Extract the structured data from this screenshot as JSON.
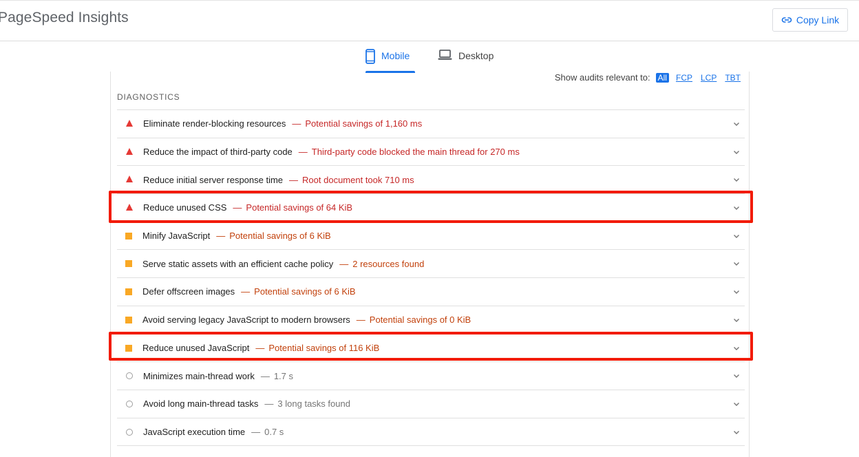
{
  "app": {
    "title": "PageSpeed Insights",
    "copy_link_label": "Copy Link"
  },
  "tabs": [
    {
      "label": "Mobile",
      "icon": "phone-icon",
      "active": true
    },
    {
      "label": "Desktop",
      "icon": "laptop-icon",
      "active": false
    }
  ],
  "filter": {
    "label": "Show audits relevant to:",
    "options": [
      "All",
      "FCP",
      "LCP",
      "TBT"
    ],
    "selected": "All"
  },
  "section": {
    "title": "DIAGNOSTICS"
  },
  "audits": [
    {
      "status": "fail",
      "title": "Eliminate render-blocking resources",
      "detail": "Potential savings of 1,160 ms"
    },
    {
      "status": "fail",
      "title": "Reduce the impact of third-party code",
      "detail": "Third-party code blocked the main thread for 270 ms"
    },
    {
      "status": "fail",
      "title": "Reduce initial server response time",
      "detail": "Root document took 710 ms"
    },
    {
      "status": "fail",
      "title": "Reduce unused CSS",
      "detail": "Potential savings of 64 KiB",
      "highlighted": true
    },
    {
      "status": "average",
      "title": "Minify JavaScript",
      "detail": "Potential savings of 6 KiB"
    },
    {
      "status": "average",
      "title": "Serve static assets with an efficient cache policy",
      "detail": "2 resources found"
    },
    {
      "status": "average",
      "title": "Defer offscreen images",
      "detail": "Potential savings of 6 KiB"
    },
    {
      "status": "average",
      "title": "Avoid serving legacy JavaScript to modern browsers",
      "detail": "Potential savings of 0 KiB"
    },
    {
      "status": "average",
      "title": "Reduce unused JavaScript",
      "detail": "Potential savings of 116 KiB",
      "highlighted": true
    },
    {
      "status": "info",
      "title": "Minimizes main-thread work",
      "detail": "1.7 s"
    },
    {
      "status": "info",
      "title": "Avoid long main-thread tasks",
      "detail": "3 long tasks found"
    },
    {
      "status": "info",
      "title": "JavaScript execution time",
      "detail": "0.7 s"
    }
  ],
  "separator": "—",
  "colors": {
    "accent": "#1a73e8",
    "fail": "#e53935",
    "average": "#f9a825",
    "highlight": "#f21b05"
  }
}
